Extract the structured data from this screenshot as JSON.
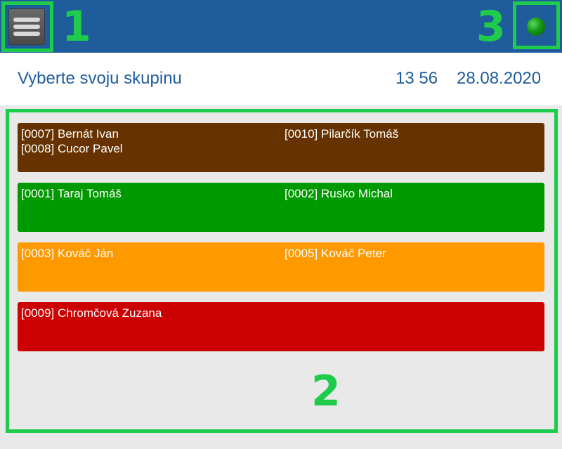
{
  "header": {
    "title": "Vyberte svoju skupinu",
    "time": "13 56",
    "date": "28.08.2020"
  },
  "icons": {
    "menu": "hamburger-menu-icon",
    "status": "green-status-dot-icon"
  },
  "colors": {
    "topbar": "#1f5c9c",
    "accent_text": "#1f5c9c",
    "callout": "#1ecb4a",
    "status_ok": "#149a14"
  },
  "callouts": {
    "menu": "1",
    "groups": "2",
    "status": "3"
  },
  "groups": [
    {
      "color": "#663300",
      "col1": [
        "[0007] Bernát Ivan",
        "[0008] Cucor Pavel"
      ],
      "col2": [
        "[0010] Pilarčík Tomáš"
      ]
    },
    {
      "color": "#009900",
      "col1": [
        "[0001] Taraj Tomáš"
      ],
      "col2": [
        "[0002] Rusko Michal"
      ]
    },
    {
      "color": "#ff9900",
      "col1": [
        "[0003] Kováč Ján"
      ],
      "col2": [
        "[0005] Kováč Peter"
      ]
    },
    {
      "color": "#cc0000",
      "col1": [
        "[0009] Chromčová Zuzana"
      ],
      "col2": []
    }
  ]
}
